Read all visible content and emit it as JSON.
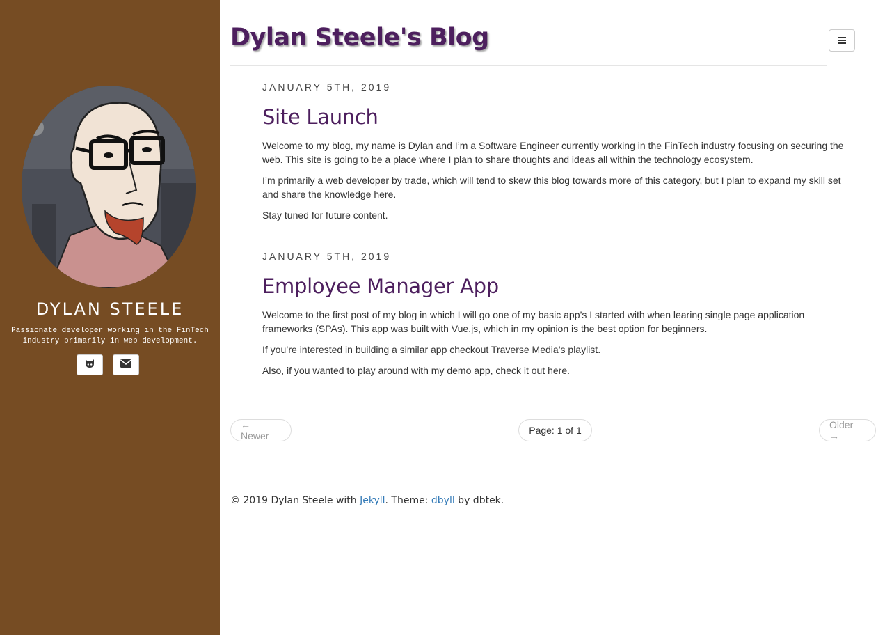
{
  "site": {
    "title": "Dylan Steele's Blog"
  },
  "sidebar": {
    "author_name": "DYLAN STEELE",
    "bio_line1": "Passionate developer working in the FinTech",
    "bio_line2": "industry primarily in web development.",
    "social": [
      {
        "icon": "github-icon"
      },
      {
        "icon": "mail-icon"
      }
    ],
    "background_color": "#764c23"
  },
  "posts": [
    {
      "date": "JANUARY 5TH, 2019",
      "title": "Site Launch",
      "paragraphs": [
        "Welcome to my blog, my name is Dylan and I’m a Software Engineer currently working in the FinTech industry focusing on securing the web. This site is going to be a place where I plan to share thoughts and ideas all within the technology ecosystem.",
        "I’m primarily a web developer by trade, which will tend to skew this blog towards more of this category, but I plan to expand my skill set and share the knowledge here.",
        "Stay tuned for future content."
      ]
    },
    {
      "date": "JANUARY 5TH, 2019",
      "title": "Employee Manager App",
      "paragraphs": [
        "Welcome to the first post of my blog in which I will go one of my basic app’s I started with when learing single page application frameworks (SPAs). This app was built with Vue.js, which in my opinion is the best option for beginners.",
        "If you’re interested in building a similar app checkout Traverse Media’s playlist.",
        "Also, if you wanted to play around with my demo app, check it out here."
      ]
    }
  ],
  "pager": {
    "newer": "← Newer",
    "page": "Page: 1 of 1",
    "older": "Older →"
  },
  "footer": {
    "prefix": "© 2019 Dylan Steele with ",
    "jekyll": "Jekyll",
    "theme_text": ". Theme: ",
    "theme_link": "dbyll",
    "suffix": " by dbtek."
  },
  "colors": {
    "title": "#4d1f5e",
    "link": "#337ab7"
  }
}
